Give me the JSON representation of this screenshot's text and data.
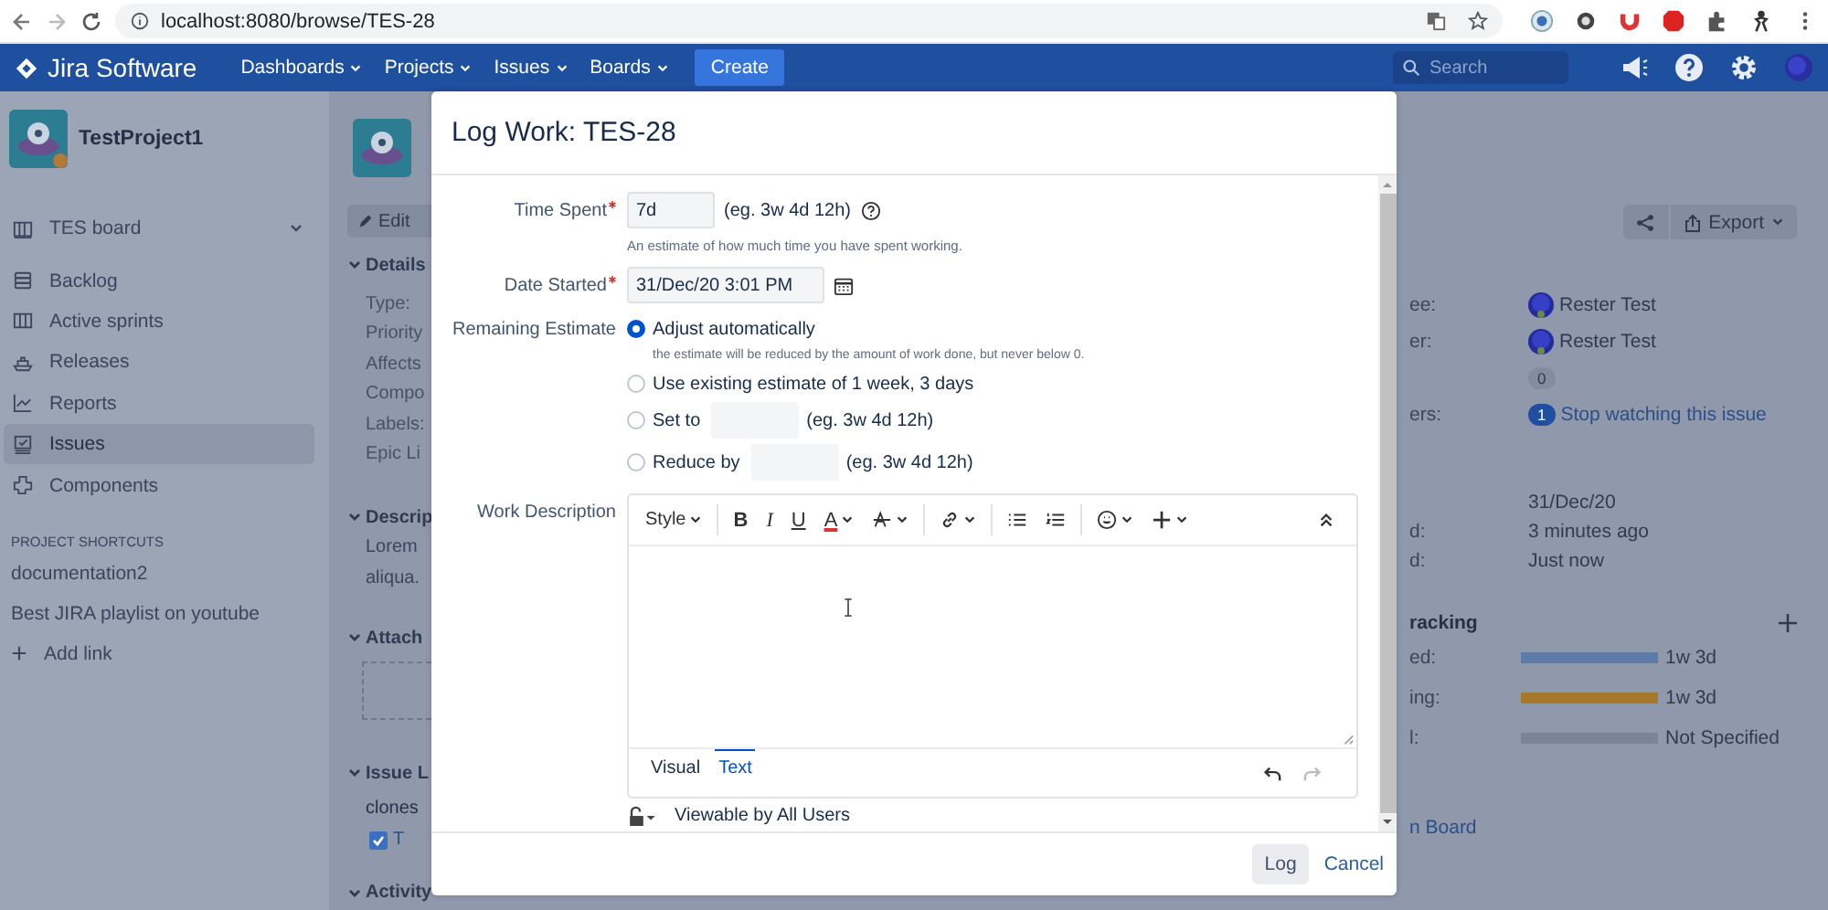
{
  "browser": {
    "url": "localhost:8080/browse/TES-28"
  },
  "nav": {
    "product": "Jira Software",
    "menus": [
      "Dashboards",
      "Projects",
      "Issues",
      "Boards"
    ],
    "create": "Create",
    "search": {
      "placeholder": "Search"
    }
  },
  "sidebar": {
    "project": "TestProject1",
    "board": "TES board",
    "items": [
      {
        "label": "Backlog",
        "kind": "backlog",
        "selected": false
      },
      {
        "label": "Active sprints",
        "kind": "sprints",
        "selected": false
      },
      {
        "label": "Releases",
        "kind": "releases",
        "selected": false
      },
      {
        "label": "Reports",
        "kind": "reports",
        "selected": false
      },
      {
        "label": "Issues",
        "kind": "issues",
        "selected": true
      },
      {
        "label": "Components",
        "kind": "components",
        "selected": false
      }
    ],
    "shortcuts_heading": "PROJECT SHORTCUTS",
    "shortcuts": [
      "documentation2",
      "Best JIRA playlist on youtube"
    ],
    "add_link": "Add link"
  },
  "issue": {
    "edit": "Edit",
    "sections": [
      {
        "kind": "fields",
        "title": "Details",
        "lines": [
          "Type:",
          "Priority",
          "Affects",
          "Compo",
          "Labels:",
          "Epic Li"
        ]
      },
      {
        "kind": "text",
        "title": "Descrip",
        "lines": [
          "Lorem",
          "aliqua."
        ]
      },
      {
        "kind": "dropzone",
        "title": "Attach"
      },
      {
        "kind": "links",
        "title": "Issue L",
        "lines": [
          "clones"
        ],
        "link": "T"
      },
      {
        "kind": "plain",
        "title": "Activity"
      }
    ],
    "export": "Export",
    "people": [
      {
        "kind": "user",
        "label": "ee:",
        "value": "Rester Test"
      },
      {
        "kind": "user",
        "label": "er:",
        "value": "Rester Test"
      },
      {
        "kind": "count",
        "badge": "0"
      },
      {
        "kind": "watch",
        "label": "ers:",
        "badge": "1",
        "value": "Stop watching this issue"
      }
    ],
    "dates": [
      {
        "value": "31/Dec/20"
      },
      {
        "label": "d:",
        "value": "3 minutes ago"
      },
      {
        "label": "d:",
        "value": "Just now"
      }
    ],
    "time_tracking": {
      "title": "racking",
      "rows": [
        {
          "label": "ed:",
          "value": "1w 3d",
          "color": "#5d7ba6"
        },
        {
          "label": "ing:",
          "value": "1w 3d",
          "color": "#a6782a"
        },
        {
          "label": "l:",
          "value": "Not Specified",
          "color": "#7c8597"
        }
      ]
    },
    "agile_link": "n Board"
  },
  "dialog": {
    "title": "Log Work: TES-28",
    "time_spent": {
      "label": "Time Spent",
      "required": true,
      "value": "7d",
      "example": "(eg. 3w 4d 12h)",
      "hint": "An estimate of how much time you have spent working."
    },
    "date_started": {
      "label": "Date Started",
      "required": true,
      "value": "31/Dec/20 3:01 PM"
    },
    "remaining": {
      "label": "Remaining Estimate",
      "options": [
        {
          "label": "Adjust automatically",
          "selected": true,
          "note": "the estimate will be reduced by the amount of work done, but never below 0."
        },
        {
          "label": "Use existing estimate of 1 week, 3 days",
          "selected": false
        },
        {
          "label": "Set to",
          "selected": false,
          "example": "(eg. 3w 4d 12h)"
        },
        {
          "label": "Reduce by",
          "selected": false,
          "example": "(eg. 3w 4d 12h)"
        }
      ]
    },
    "work_description": {
      "label": "Work Description",
      "toolbar": [
        [
          {
            "kind": "style",
            "label": "Style"
          }
        ],
        [
          {
            "kind": "bold",
            "label": "B"
          },
          {
            "kind": "italic",
            "label": "I"
          },
          {
            "kind": "underline",
            "label": "U"
          },
          {
            "kind": "color",
            "label": "A"
          },
          {
            "kind": "format"
          }
        ],
        [
          {
            "kind": "link"
          }
        ],
        [
          {
            "kind": "bullets"
          },
          {
            "kind": "numbers"
          }
        ],
        [
          {
            "kind": "emoji"
          },
          {
            "kind": "insert"
          }
        ]
      ],
      "tabs": [
        {
          "label": "Visual",
          "selected": false
        },
        {
          "label": "Text",
          "selected": true
        }
      ]
    },
    "visibility": "Viewable by All Users",
    "submit": "Log",
    "cancel": "Cancel"
  }
}
